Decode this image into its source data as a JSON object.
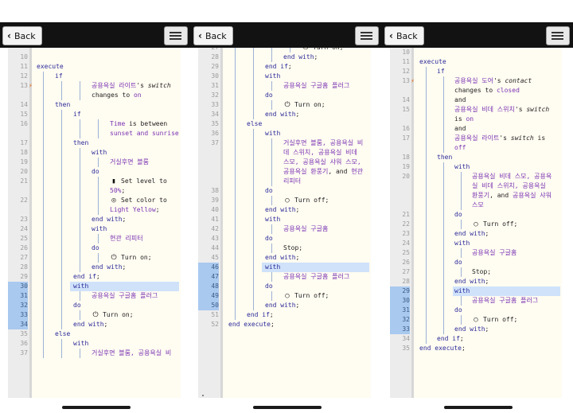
{
  "header": {
    "back_label": "Back"
  },
  "panels": [
    {
      "lines": [
        {
          "n": "10"
        },
        {
          "n": "11",
          "text": [
            [
              "kw",
              "execute"
            ]
          ]
        },
        {
          "n": "12",
          "text": [
            [
              "kw",
              "if"
            ]
          ]
        },
        {
          "n": "13",
          "text": [
            [
              "dv",
              "공용욕실 라이트"
            ],
            [
              "blk",
              "'s "
            ],
            [
              "it",
              "switch"
            ]
          ],
          "bolt": true
        },
        {
          "n": "",
          "text": [
            [
              "blk",
              "changes to "
            ],
            [
              "dv",
              "on"
            ]
          ]
        },
        {
          "n": "14",
          "text": [
            [
              "kw",
              "then"
            ]
          ]
        },
        {
          "n": "15",
          "text": [
            [
              "kw",
              "if"
            ]
          ]
        },
        {
          "n": "16",
          "text": [
            [
              "dv",
              "Time"
            ],
            [
              "blk",
              " is between"
            ]
          ]
        },
        {
          "n": "",
          "text": [
            [
              "dv",
              "sunset and sunrise"
            ]
          ]
        },
        {
          "n": "17",
          "text": [
            [
              "kw",
              "then"
            ]
          ]
        },
        {
          "n": "18",
          "text": [
            [
              "kw",
              "with"
            ]
          ]
        },
        {
          "n": "19",
          "text": [
            [
              "dv",
              "거실후면 블룸"
            ]
          ]
        },
        {
          "n": "20",
          "text": [
            [
              "kw",
              "do"
            ]
          ]
        },
        {
          "n": "21",
          "icon": "signal-icon",
          "text": [
            [
              "blk",
              "Set level to"
            ]
          ]
        },
        {
          "n": "",
          "text": [
            [
              "dv",
              "50%"
            ],
            [
              "blk",
              ";"
            ]
          ]
        },
        {
          "n": "22",
          "icon": "palette-icon",
          "text": [
            [
              "blk",
              "Set color to"
            ]
          ]
        },
        {
          "n": "",
          "text": [
            [
              "dv",
              "Light Yellow"
            ],
            [
              "blk",
              ";"
            ]
          ]
        },
        {
          "n": "23",
          "text": [
            [
              "kw",
              "end with"
            ],
            [
              "blk",
              ";"
            ]
          ]
        },
        {
          "n": "24",
          "text": [
            [
              "kw",
              "with"
            ]
          ]
        },
        {
          "n": "25",
          "text": [
            [
              "dv",
              "현관 리피터"
            ]
          ]
        },
        {
          "n": "26",
          "text": [
            [
              "kw",
              "do"
            ]
          ]
        },
        {
          "n": "27",
          "icon": "power-icon",
          "text": [
            [
              "blk",
              "Turn on;"
            ]
          ]
        },
        {
          "n": "28",
          "text": [
            [
              "kw",
              "end with"
            ],
            [
              "blk",
              ";"
            ]
          ]
        },
        {
          "n": "29",
          "text": [
            [
              "kw",
              "end if"
            ],
            [
              "blk",
              ";"
            ]
          ]
        },
        {
          "n": "30",
          "sel": true,
          "hl": true,
          "text": [
            [
              "kw",
              "with"
            ]
          ]
        },
        {
          "n": "31",
          "sel": true,
          "text": [
            [
              "dv",
              "공용욕실 구글홈 플러그"
            ]
          ]
        },
        {
          "n": "32",
          "sel": true,
          "text": [
            [
              "kw",
              "do"
            ]
          ]
        },
        {
          "n": "33",
          "sel": true,
          "icon": "power-icon",
          "text": [
            [
              "blk",
              "Turn on;"
            ]
          ]
        },
        {
          "n": "34",
          "sel": true,
          "text": [
            [
              "kw",
              "end with"
            ],
            [
              "blk",
              ";"
            ]
          ]
        },
        {
          "n": "35",
          "text": [
            [
              "kw",
              "else"
            ]
          ]
        },
        {
          "n": "36",
          "text": [
            [
              "kw",
              "with"
            ]
          ]
        },
        {
          "n": "37",
          "text": [
            [
              "dv",
              "거실후면 블룸, 공용욕실 비"
            ]
          ]
        }
      ]
    },
    {
      "lines": [
        {
          "n": "27",
          "icon": "power-icon",
          "text": [
            [
              "blk",
              "Turn on;"
            ]
          ]
        },
        {
          "n": "28",
          "text": [
            [
              "kw",
              "end with"
            ],
            [
              "blk",
              ";"
            ]
          ]
        },
        {
          "n": "29",
          "text": [
            [
              "kw",
              "end if"
            ],
            [
              "blk",
              ";"
            ]
          ]
        },
        {
          "n": "30",
          "text": [
            [
              "kw",
              "with"
            ]
          ]
        },
        {
          "n": "31",
          "text": [
            [
              "dv",
              "공용욕실 구글홈 플러그"
            ]
          ]
        },
        {
          "n": "32",
          "text": [
            [
              "kw",
              "do"
            ]
          ]
        },
        {
          "n": "33",
          "icon": "power-icon",
          "text": [
            [
              "blk",
              "Turn on;"
            ]
          ]
        },
        {
          "n": "34",
          "text": [
            [
              "kw",
              "end with"
            ],
            [
              "blk",
              ";"
            ]
          ]
        },
        {
          "n": "35",
          "text": [
            [
              "kw",
              "else"
            ]
          ]
        },
        {
          "n": "36",
          "text": [
            [
              "kw",
              "with"
            ]
          ]
        },
        {
          "n": "37",
          "text": [
            [
              "dv",
              "거실후면 블룸, 공용욕실 비"
            ]
          ]
        },
        {
          "n": "",
          "text": [
            [
              "dv",
              "데 스위치, 공용욕실 비데"
            ]
          ]
        },
        {
          "n": "",
          "text": [
            [
              "dv",
              "스모, 공용욕실 샤워 스모,"
            ]
          ]
        },
        {
          "n": "",
          "text": [
            [
              "dv",
              "공용욕실 환풍기"
            ],
            [
              "blk",
              ", and "
            ],
            [
              "dv",
              "현관"
            ]
          ]
        },
        {
          "n": "",
          "text": [
            [
              "dv",
              "리피터"
            ]
          ]
        },
        {
          "n": "38",
          "text": [
            [
              "kw",
              "do"
            ]
          ]
        },
        {
          "n": "39",
          "icon": "power-off-icon",
          "text": [
            [
              "blk",
              "Turn off;"
            ]
          ]
        },
        {
          "n": "40",
          "text": [
            [
              "kw",
              "end with"
            ],
            [
              "blk",
              ";"
            ]
          ]
        },
        {
          "n": "41",
          "text": [
            [
              "kw",
              "with"
            ]
          ]
        },
        {
          "n": "42",
          "text": [
            [
              "dv",
              "공용욕실 구글홈"
            ]
          ]
        },
        {
          "n": "43",
          "text": [
            [
              "kw",
              "do"
            ]
          ]
        },
        {
          "n": "44",
          "text": [
            [
              "blk",
              "Stop;"
            ]
          ]
        },
        {
          "n": "45",
          "text": [
            [
              "kw",
              "end with"
            ],
            [
              "blk",
              ";"
            ]
          ]
        },
        {
          "n": "46",
          "sel": true,
          "hl": true,
          "text": [
            [
              "kw",
              "with"
            ]
          ]
        },
        {
          "n": "47",
          "sel": true,
          "text": [
            [
              "dv",
              "공용욕실 구글홈 플러그"
            ]
          ]
        },
        {
          "n": "48",
          "sel": true,
          "text": [
            [
              "kw",
              "do"
            ]
          ]
        },
        {
          "n": "49",
          "sel": true,
          "icon": "power-off-icon",
          "text": [
            [
              "blk",
              "Turn off;"
            ]
          ]
        },
        {
          "n": "50",
          "sel": true,
          "text": [
            [
              "kw",
              "end with"
            ],
            [
              "blk",
              ";"
            ]
          ]
        },
        {
          "n": "51",
          "text": [
            [
              "kw",
              "end if"
            ],
            [
              "blk",
              ";"
            ]
          ]
        },
        {
          "n": "52",
          "text": [
            [
              "kw",
              "end execute"
            ],
            [
              "blk",
              ";"
            ]
          ]
        }
      ]
    },
    {
      "lines": [
        {
          "n": "10"
        },
        {
          "n": "11",
          "text": [
            [
              "kw",
              "execute"
            ]
          ]
        },
        {
          "n": "12",
          "text": [
            [
              "kw",
              "if"
            ]
          ]
        },
        {
          "n": "13",
          "text": [
            [
              "dv",
              "공용욕실 도어"
            ],
            [
              "blk",
              "'s "
            ],
            [
              "it",
              "contact"
            ]
          ],
          "bolt": true
        },
        {
          "n": "",
          "text": [
            [
              "blk",
              "changes to "
            ],
            [
              "dv",
              "closed"
            ]
          ]
        },
        {
          "n": "14",
          "text": [
            [
              "blk",
              "and"
            ]
          ]
        },
        {
          "n": "15",
          "text": [
            [
              "dv",
              "공용욕실 비데 스위치"
            ],
            [
              "blk",
              "'s "
            ],
            [
              "it",
              "switch"
            ]
          ]
        },
        {
          "n": "",
          "text": [
            [
              "blk",
              "is "
            ],
            [
              "dv",
              "on"
            ]
          ]
        },
        {
          "n": "16",
          "text": [
            [
              "blk",
              "and"
            ]
          ]
        },
        {
          "n": "17",
          "text": [
            [
              "dv",
              "공용욕실 라이트"
            ],
            [
              "blk",
              "'s "
            ],
            [
              "it",
              "switch"
            ],
            [
              "blk",
              " is"
            ]
          ]
        },
        {
          "n": "",
          "text": [
            [
              "dv",
              "off"
            ]
          ]
        },
        {
          "n": "18",
          "text": [
            [
              "kw",
              "then"
            ]
          ]
        },
        {
          "n": "19",
          "text": [
            [
              "kw",
              "with"
            ]
          ]
        },
        {
          "n": "20",
          "text": [
            [
              "dv",
              "공용욕실 비데 스모, 공용욕"
            ]
          ]
        },
        {
          "n": "",
          "text": [
            [
              "dv",
              "실 비데 스위치, 공용욕실"
            ]
          ]
        },
        {
          "n": "",
          "text": [
            [
              "dv",
              "환풍기"
            ],
            [
              "blk",
              ", and "
            ],
            [
              "dv",
              "공용욕실 샤워"
            ]
          ]
        },
        {
          "n": "",
          "text": [
            [
              "dv",
              "스모"
            ]
          ]
        },
        {
          "n": "21",
          "text": [
            [
              "kw",
              "do"
            ]
          ]
        },
        {
          "n": "22",
          "icon": "power-off-icon",
          "text": [
            [
              "blk",
              "Turn off;"
            ]
          ]
        },
        {
          "n": "23",
          "text": [
            [
              "kw",
              "end with"
            ],
            [
              "blk",
              ";"
            ]
          ]
        },
        {
          "n": "24",
          "text": [
            [
              "kw",
              "with"
            ]
          ]
        },
        {
          "n": "25",
          "text": [
            [
              "dv",
              "공용욕실 구글홈"
            ]
          ]
        },
        {
          "n": "26",
          "text": [
            [
              "kw",
              "do"
            ]
          ]
        },
        {
          "n": "27",
          "text": [
            [
              "blk",
              "Stop;"
            ]
          ]
        },
        {
          "n": "28",
          "text": [
            [
              "kw",
              "end with"
            ],
            [
              "blk",
              ";"
            ]
          ]
        },
        {
          "n": "29",
          "sel": true,
          "hl": true,
          "text": [
            [
              "kw",
              "with"
            ]
          ]
        },
        {
          "n": "30",
          "sel": true,
          "text": [
            [
              "dv",
              "공용욕실 구글홈 플러그"
            ]
          ]
        },
        {
          "n": "31",
          "sel": true,
          "text": [
            [
              "kw",
              "do"
            ]
          ]
        },
        {
          "n": "32",
          "sel": true,
          "icon": "power-off-icon",
          "text": [
            [
              "blk",
              "Turn off;"
            ]
          ]
        },
        {
          "n": "33",
          "sel": true,
          "text": [
            [
              "kw",
              "end with"
            ],
            [
              "blk",
              ";"
            ]
          ]
        },
        {
          "n": "34",
          "text": [
            [
              "kw",
              "end if"
            ],
            [
              "blk",
              ";"
            ]
          ]
        },
        {
          "n": "35",
          "text": [
            [
              "kw",
              "end execute"
            ],
            [
              "blk",
              ";"
            ]
          ]
        }
      ]
    }
  ]
}
